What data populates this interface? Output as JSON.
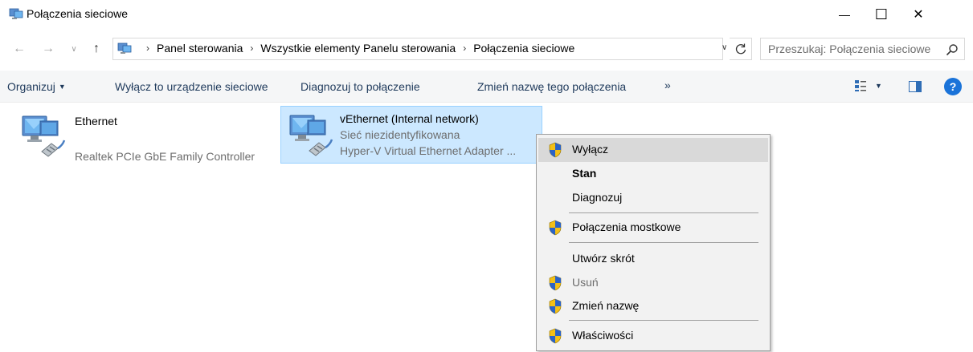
{
  "window": {
    "title": "Połączenia sieciowe",
    "controls": {
      "minimize": "—",
      "maximize": "☐",
      "close": "✕"
    }
  },
  "address": {
    "crumbs": [
      "Panel sterowania",
      "Wszystkie elementy Panelu sterowania",
      "Połączenia sieciowe"
    ],
    "search_placeholder": "Przeszukaj: Połączenia sieciowe"
  },
  "toolbar": {
    "organize": "Organizuj",
    "disable_device": "Wyłącz to urządzenie sieciowe",
    "diagnose": "Diagnozuj to połączenie",
    "rename": "Zmień nazwę tego połączenia",
    "more": "»",
    "help": "?"
  },
  "connections": [
    {
      "name": "Ethernet",
      "status": "",
      "adapter": "Realtek PCIe GbE Family Controller",
      "selected": false
    },
    {
      "name": "vEthernet (Internal network)",
      "status": "Sieć niezidentyfikowana",
      "adapter": "Hyper-V Virtual Ethernet Adapter ...",
      "selected": true
    }
  ],
  "context_menu": {
    "items": [
      {
        "label": "Wyłącz",
        "shield": true,
        "highlighted": true
      },
      {
        "label": "Stan",
        "bold": true
      },
      {
        "label": "Diagnozuj"
      },
      {
        "label": "Połączenia mostkowe",
        "shield": true
      },
      {
        "label": "Utwórz skrót"
      },
      {
        "label": "Usuń",
        "shield": true,
        "disabled": true
      },
      {
        "label": "Zmień nazwę",
        "shield": true
      },
      {
        "label": "Właściwości",
        "shield": true
      }
    ]
  },
  "colors": {
    "selection_bg": "#cce8ff",
    "selection_border": "#99d1ff",
    "command_text": "#1e395b",
    "menu_bg": "#f2f2f2",
    "menu_highlight": "#d9d9d9",
    "shield_blue": "#2b63c6",
    "shield_yellow": "#f4c016"
  },
  "icons": {
    "title": "network-connections-icon",
    "address": "network-connections-icon",
    "connection": "network-adapter-icon",
    "menu_admin": "uac-shield-icon"
  }
}
